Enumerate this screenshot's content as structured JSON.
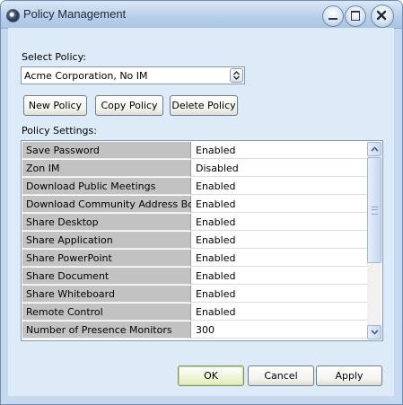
{
  "window": {
    "title": "Policy Management"
  },
  "select_policy": {
    "label": "Select Policy:",
    "value": "Acme Corporation, No IM"
  },
  "policy_buttons": {
    "new": "New Policy",
    "copy": "Copy Policy",
    "delete": "Delete Policy"
  },
  "settings": {
    "label": "Policy Settings:",
    "rows": [
      {
        "name": "Save Password",
        "value": "Enabled"
      },
      {
        "name": "Zon IM",
        "value": "Disabled"
      },
      {
        "name": "Download Public Meetings",
        "value": "Enabled"
      },
      {
        "name": "Download Community Address Book",
        "value": "Enabled"
      },
      {
        "name": "Share Desktop",
        "value": "Enabled"
      },
      {
        "name": "Share Application",
        "value": "Enabled"
      },
      {
        "name": "Share PowerPoint",
        "value": "Enabled"
      },
      {
        "name": "Share Document",
        "value": "Enabled"
      },
      {
        "name": "Share Whiteboard",
        "value": "Enabled"
      },
      {
        "name": "Remote Control",
        "value": "Enabled"
      },
      {
        "name": "Number of Presence Monitors",
        "value": "300"
      }
    ]
  },
  "dialog_buttons": {
    "ok": "OK",
    "cancel": "Cancel",
    "apply": "Apply"
  },
  "icons": {
    "app": "app-icon",
    "minimize": "minimize-icon",
    "maximize": "maximize-icon",
    "close": "close-icon",
    "dropdown": "dropdown-arrows-icon",
    "scroll_up": "chevron-up-icon",
    "scroll_down": "chevron-down-icon"
  },
  "colors": {
    "dialog_background": "#ddebf8",
    "name_cell": "#c2c2c2",
    "ok_button_tint": "#dfeab8"
  }
}
